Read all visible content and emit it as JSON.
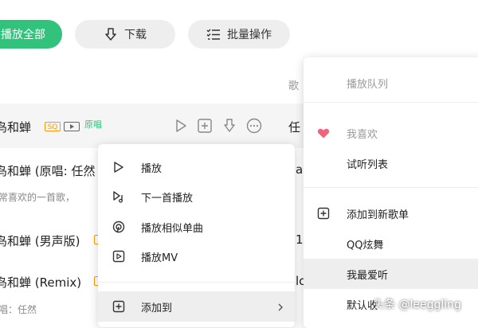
{
  "toolbar": {
    "play_all_label": "播放全部",
    "download_label": "下载",
    "batch_label": "批量操作"
  },
  "list": {
    "column_header": "歌",
    "rows": [
      {
        "title": "鸟和蝉",
        "badges": [
          "SQ",
          "MV"
        ],
        "tag": "原唱",
        "artist": "任"
      },
      {
        "title": "鸟和蝉 (原唱: 任然",
        "subtitle": "常喜欢的一首歌，",
        "artist": "a"
      },
      {
        "title": "鸟和蝉 (男声版)",
        "artist": "1"
      },
      {
        "title": "鸟和蝉 (Remix)",
        "subtitle": "唱：任然",
        "artist": "lc"
      }
    ]
  },
  "context_menu": {
    "items": [
      {
        "label": "播放",
        "icon": "play-icon"
      },
      {
        "label": "下一首播放",
        "icon": "play-next-icon"
      },
      {
        "label": "播放相似单曲",
        "icon": "radar-icon"
      },
      {
        "label": "播放MV",
        "icon": "mv-icon"
      },
      {
        "label": "添加到",
        "icon": "add-square-icon",
        "has_submenu": true
      }
    ]
  },
  "submenu": {
    "items": [
      {
        "label": "播放队列",
        "muted": true
      },
      {
        "label": "我喜欢",
        "muted": true,
        "icon": "heart-icon"
      },
      {
        "label": "试听列表"
      },
      {
        "label": "添加到新歌单",
        "icon": "add-square-icon"
      },
      {
        "label": "QQ炫舞"
      },
      {
        "label": "我最爱听",
        "hover": true
      },
      {
        "label": "默认收"
      }
    ]
  },
  "watermark": "头条 @leeggling",
  "colors": {
    "accent": "#31c27c",
    "badge_orange": "#ff9a00",
    "heart": "#f0637a"
  }
}
